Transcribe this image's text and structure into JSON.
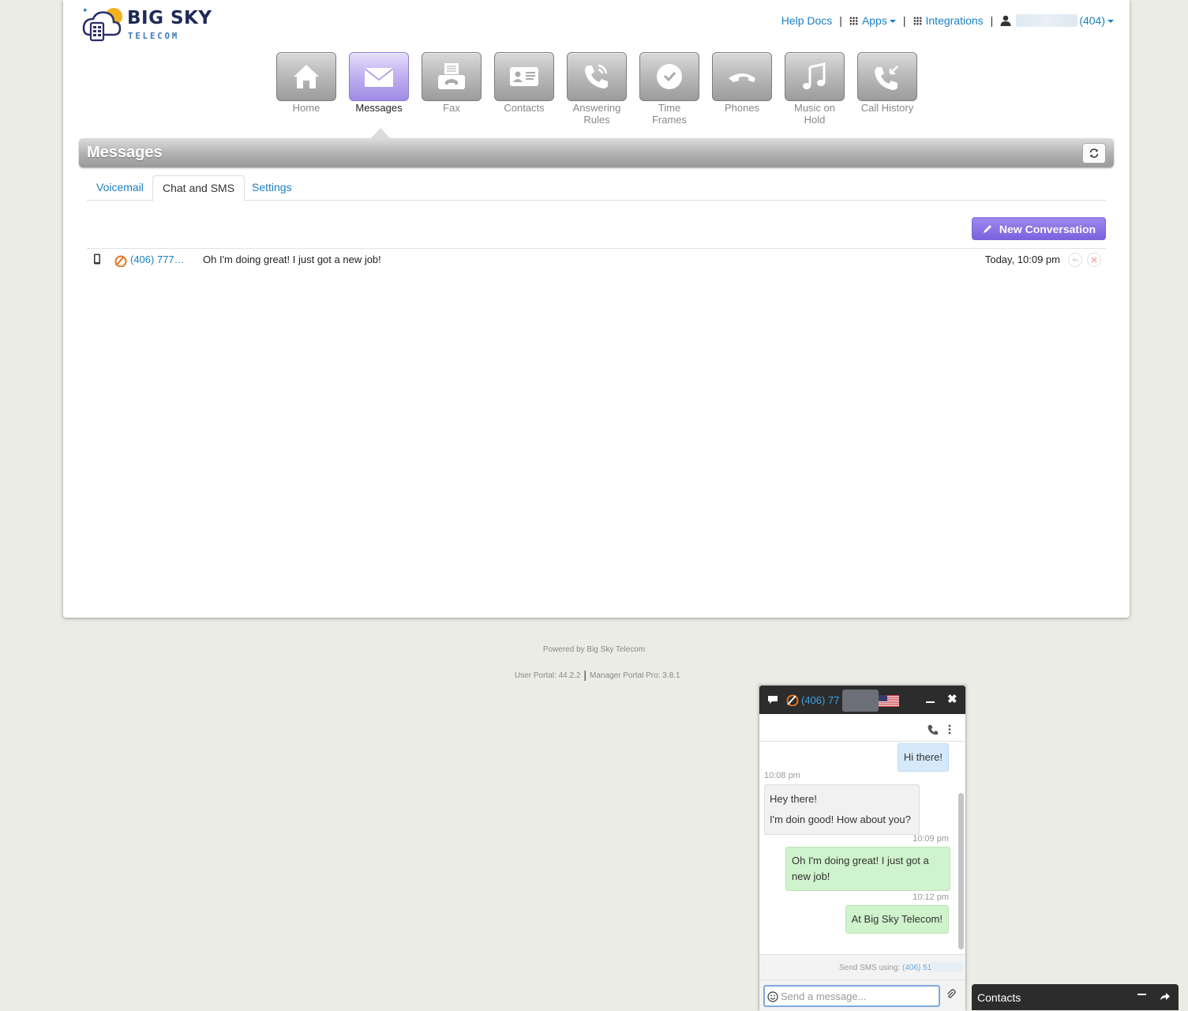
{
  "brand": {
    "name": "BIG SKY",
    "tagline": "TELECOM"
  },
  "toplinks": {
    "help": "Help Docs",
    "apps": "Apps",
    "integrations": "Integrations",
    "user_ext": "(404)"
  },
  "nav": [
    {
      "label": "Home",
      "icon": "home-icon"
    },
    {
      "label": "Messages",
      "icon": "envelope-icon",
      "active": true
    },
    {
      "label": "Fax",
      "icon": "fax-icon"
    },
    {
      "label": "Contacts",
      "icon": "contact-card-icon"
    },
    {
      "label": "Answering Rules",
      "icon": "phone-ringing-icon"
    },
    {
      "label": "Time Frames",
      "icon": "clock-icon"
    },
    {
      "label": "Phones",
      "icon": "handset-icon"
    },
    {
      "label": "Music on Hold",
      "icon": "music-note-icon"
    },
    {
      "label": "Call History",
      "icon": "call-history-icon"
    }
  ],
  "page": {
    "title": "Messages",
    "tabs": [
      "Voicemail",
      "Chat and SMS",
      "Settings"
    ],
    "active_tab": "Chat and SMS",
    "new_conversation": "New Conversation"
  },
  "conversations": [
    {
      "number": "(406) 777…",
      "preview": "Oh I'm doing great! I just got a new job!",
      "time": "Today, 10:09 pm"
    }
  ],
  "footer": {
    "powered": "Powered by Big Sky Telecom",
    "user_portal": "User Portal: 44.2.2",
    "manager_portal": "Manager Portal Pro: 3.8.1"
  },
  "chat_window": {
    "number": "(406) 77",
    "messages": [
      {
        "dir": "out-blue",
        "text": "Hi there!"
      },
      {
        "time": "10:08 pm"
      },
      {
        "dir": "in",
        "lines": [
          "Hey there!",
          "I'm doin good! How about you?"
        ]
      },
      {
        "time": "10:09 pm"
      },
      {
        "dir": "out",
        "text": "Oh I'm doing great! I just got a new job!"
      },
      {
        "time": "10:12 pm"
      },
      {
        "dir": "out",
        "text": "At Big Sky Telecom!"
      }
    ],
    "send_using_label": "Send SMS using:",
    "send_using_number": "(406) 51",
    "input_placeholder": "Send a message..."
  },
  "contacts_dock": {
    "label": "Contacts"
  },
  "colors": {
    "accent": "#1a7fc1",
    "brand_purple": "#8a73e6",
    "chat_out": "#cff3cc"
  }
}
